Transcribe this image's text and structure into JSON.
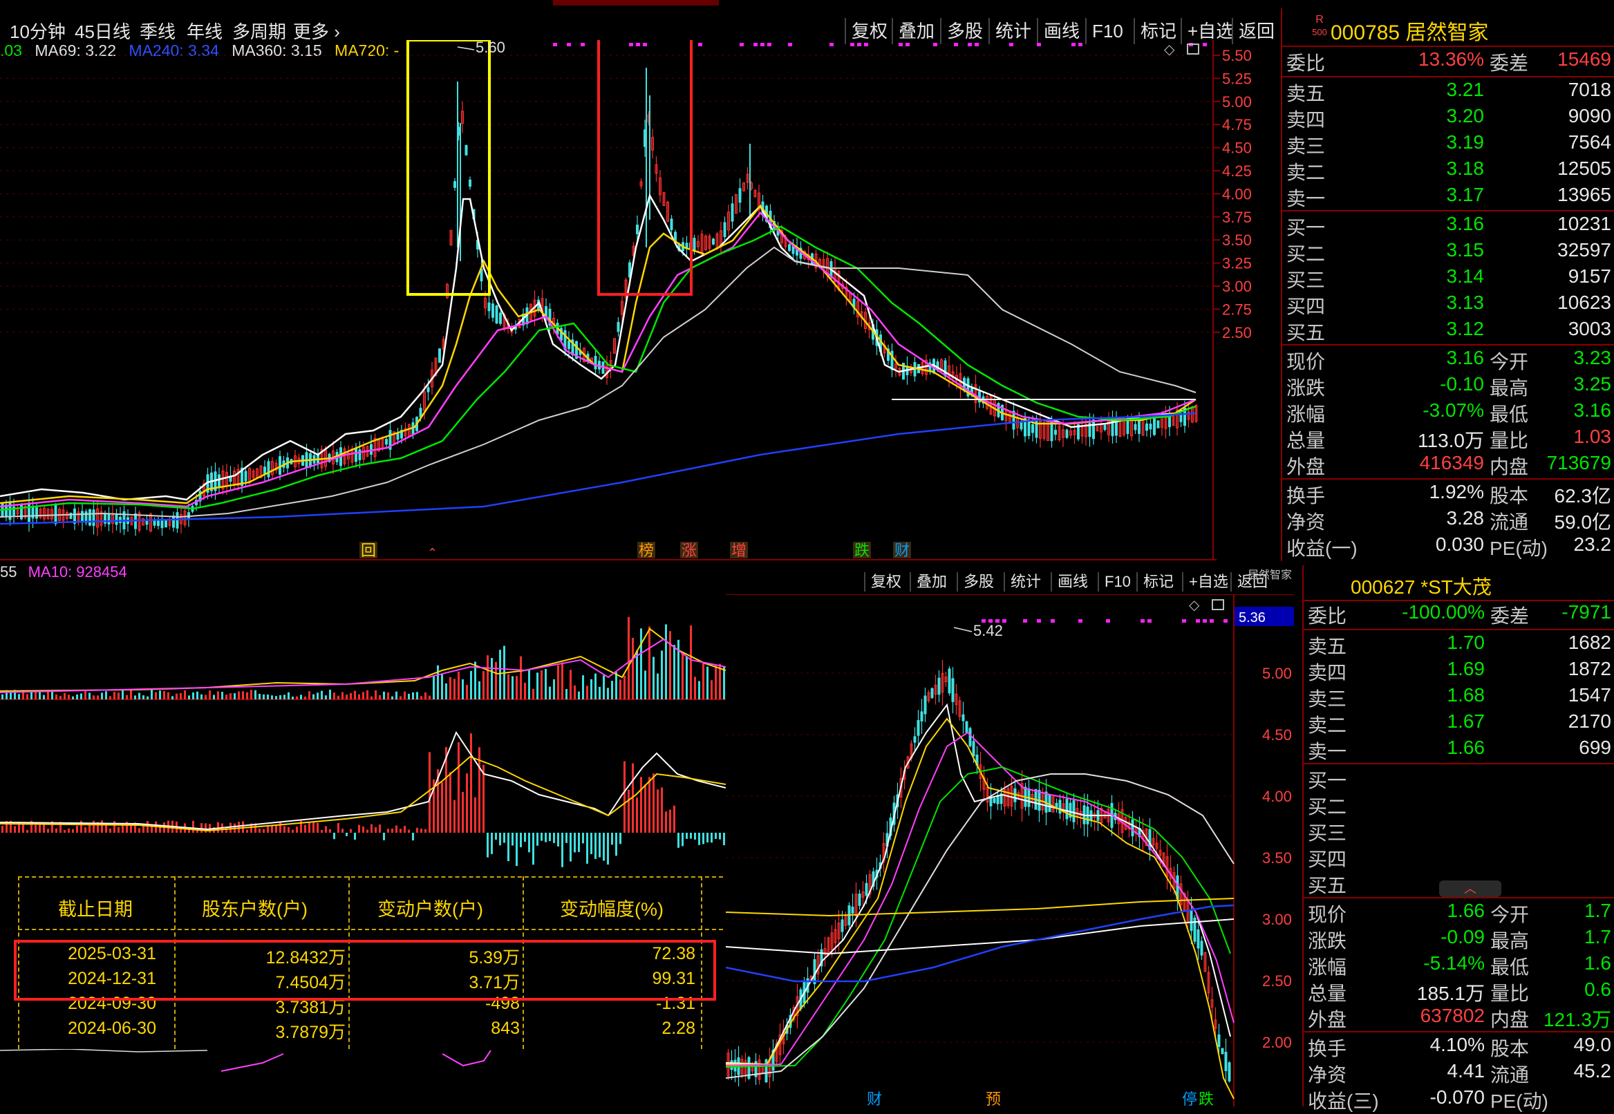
{
  "window_title": "居然智家",
  "toolbar": {
    "periods": [
      "10分钟",
      "45日线",
      "季线",
      "年线",
      "多周期",
      "更多"
    ],
    "buttons": [
      "复权",
      "叠加",
      "多股",
      "统计",
      "画线",
      "F10",
      "标记",
      "+自选",
      "返回"
    ]
  },
  "main_chart": {
    "ma_legend": [
      {
        "text": ".03",
        "color": "#00e600"
      },
      {
        "text": "MA69: 3.22",
        "color": "#e0e0e0"
      },
      {
        "text": "MA240: 3.34",
        "color": "#3050ff"
      },
      {
        "text": "MA360: 3.15",
        "color": "#e0e0e0"
      },
      {
        "text": "MA720: -",
        "color": "#ffd700"
      }
    ],
    "peak_label": "5.60",
    "price_ticks": [
      "5.50",
      "5.25",
      "5.00",
      "4.75",
      "4.50",
      "4.25",
      "4.00",
      "3.75",
      "3.50",
      "3.25",
      "3.00",
      "2.75",
      "2.50"
    ],
    "event_marks": [
      {
        "text": "回",
        "color": "#ffd700"
      },
      {
        "text": "榜",
        "color": "#ff9900"
      },
      {
        "text": "涨",
        "color": "#ff4040"
      },
      {
        "text": "增",
        "color": "#ff4040"
      },
      {
        "text": "跌",
        "color": "#00e600"
      },
      {
        "text": "财",
        "color": "#00a0ff"
      }
    ]
  },
  "volume_legend": {
    "left": "55",
    "ma10": "MA10: 928454"
  },
  "quote1": {
    "badge_top": "R",
    "badge_bottom": "500",
    "code": "000785",
    "name": "居然智家",
    "weibi_label": "委比",
    "weibi": "13.36%",
    "weicha_label": "委差",
    "weicha": "15469",
    "asks": [
      {
        "label": "卖五",
        "price": "3.21",
        "vol": "7018"
      },
      {
        "label": "卖四",
        "price": "3.20",
        "vol": "9090"
      },
      {
        "label": "卖三",
        "price": "3.19",
        "vol": "7564"
      },
      {
        "label": "卖二",
        "price": "3.18",
        "vol": "12505"
      },
      {
        "label": "卖一",
        "price": "3.17",
        "vol": "13965"
      }
    ],
    "bids": [
      {
        "label": "买一",
        "price": "3.16",
        "vol": "10231"
      },
      {
        "label": "买二",
        "price": "3.15",
        "vol": "32597"
      },
      {
        "label": "买三",
        "price": "3.14",
        "vol": "9157"
      },
      {
        "label": "买四",
        "price": "3.13",
        "vol": "10623"
      },
      {
        "label": "买五",
        "price": "3.12",
        "vol": "3003"
      }
    ],
    "stats": [
      {
        "l1": "现价",
        "v1": "3.16",
        "c1": "green",
        "l2": "今开",
        "v2": "3.23",
        "c2": "green"
      },
      {
        "l1": "涨跌",
        "v1": "-0.10",
        "c1": "green",
        "l2": "最高",
        "v2": "3.25",
        "c2": "green"
      },
      {
        "l1": "涨幅",
        "v1": "-3.07%",
        "c1": "green",
        "l2": "最低",
        "v2": "3.16",
        "c2": "green"
      },
      {
        "l1": "总量",
        "v1": "113.0万",
        "c1": "white",
        "l2": "量比",
        "v2": "1.03",
        "c2": "red"
      },
      {
        "l1": "外盘",
        "v1": "416349",
        "c1": "red",
        "l2": "内盘",
        "v2": "713679",
        "c2": "green"
      },
      {
        "l1": "换手",
        "v1": "1.92%",
        "c1": "white",
        "l2": "股本",
        "v2": "62.3亿",
        "c2": "white"
      },
      {
        "l1": "净资",
        "v1": "3.28",
        "c1": "white",
        "l2": "流通",
        "v2": "59.0亿",
        "c2": "white"
      },
      {
        "l1": "收益(一)",
        "v1": "0.030",
        "c1": "white",
        "l2": "PE(动)",
        "v2": "23.2",
        "c2": "white"
      }
    ]
  },
  "second_window": {
    "buttons": [
      "复权",
      "叠加",
      "多股",
      "统计",
      "画线",
      "F10",
      "标记",
      "+自选",
      "返回"
    ],
    "tab_label": "居然智家",
    "peak_label": "5.42",
    "price_ticks": [
      "5.00",
      "4.50",
      "4.00",
      "3.50",
      "3.00",
      "2.50",
      "2.00"
    ],
    "current_price_tag": "5.36",
    "event_marks": [
      {
        "text": "财",
        "color": "#00a0ff"
      },
      {
        "text": "预",
        "color": "#ff9900"
      },
      {
        "text": "停",
        "color": "#00a0ff"
      },
      {
        "text": "跌",
        "color": "#00e600"
      }
    ]
  },
  "quote2": {
    "code": "000627",
    "name": "*ST大茂",
    "weibi_label": "委比",
    "weibi": "-100.00%",
    "weicha_label": "委差",
    "weicha": "-7971",
    "asks": [
      {
        "label": "卖五",
        "price": "1.70",
        "vol": "1682"
      },
      {
        "label": "卖四",
        "price": "1.69",
        "vol": "1872"
      },
      {
        "label": "卖三",
        "price": "1.68",
        "vol": "1547"
      },
      {
        "label": "卖二",
        "price": "1.67",
        "vol": "2170"
      },
      {
        "label": "卖一",
        "price": "1.66",
        "vol": "699"
      }
    ],
    "bids": [
      {
        "label": "买一"
      },
      {
        "label": "买二"
      },
      {
        "label": "买三"
      },
      {
        "label": "买四"
      },
      {
        "label": "买五"
      }
    ],
    "stats": [
      {
        "l1": "现价",
        "v1": "1.66",
        "c1": "green",
        "l2": "今开",
        "v2": "1.7",
        "c2": "green"
      },
      {
        "l1": "涨跌",
        "v1": "-0.09",
        "c1": "green",
        "l2": "最高",
        "v2": "1.7",
        "c2": "green"
      },
      {
        "l1": "涨幅",
        "v1": "-5.14%",
        "c1": "green",
        "l2": "最低",
        "v2": "1.6",
        "c2": "green"
      },
      {
        "l1": "总量",
        "v1": "185.1万",
        "c1": "white",
        "l2": "量比",
        "v2": "0.6",
        "c2": "green"
      },
      {
        "l1": "外盘",
        "v1": "637802",
        "c1": "red",
        "l2": "内盘",
        "v2": "121.3万",
        "c2": "green"
      },
      {
        "l1": "换手",
        "v1": "4.10%",
        "c1": "white",
        "l2": "股本",
        "v2": "49.0",
        "c2": "white"
      },
      {
        "l1": "净资",
        "v1": "4.41",
        "c1": "white",
        "l2": "流通",
        "v2": "45.2",
        "c2": "white"
      },
      {
        "l1": "收益(三)",
        "v1": "-0.070",
        "c1": "white",
        "l2": "PE(动)",
        "v2": "",
        "c2": "white"
      }
    ]
  },
  "shareholder_table": {
    "headers": [
      "截止日期",
      "股东户数(户)",
      "变动户数(户)",
      "变动幅度(%)"
    ],
    "rows": [
      [
        "2025-03-31",
        "12.8432万",
        "5.39万",
        "72.38"
      ],
      [
        "2024-12-31",
        "7.4504万",
        "3.71万",
        "99.31"
      ],
      [
        "2024-09-30",
        "3.7381万",
        "-498",
        "-1.31"
      ],
      [
        "2024-06-30",
        "3.7879万",
        "843",
        "2.28"
      ]
    ]
  }
}
